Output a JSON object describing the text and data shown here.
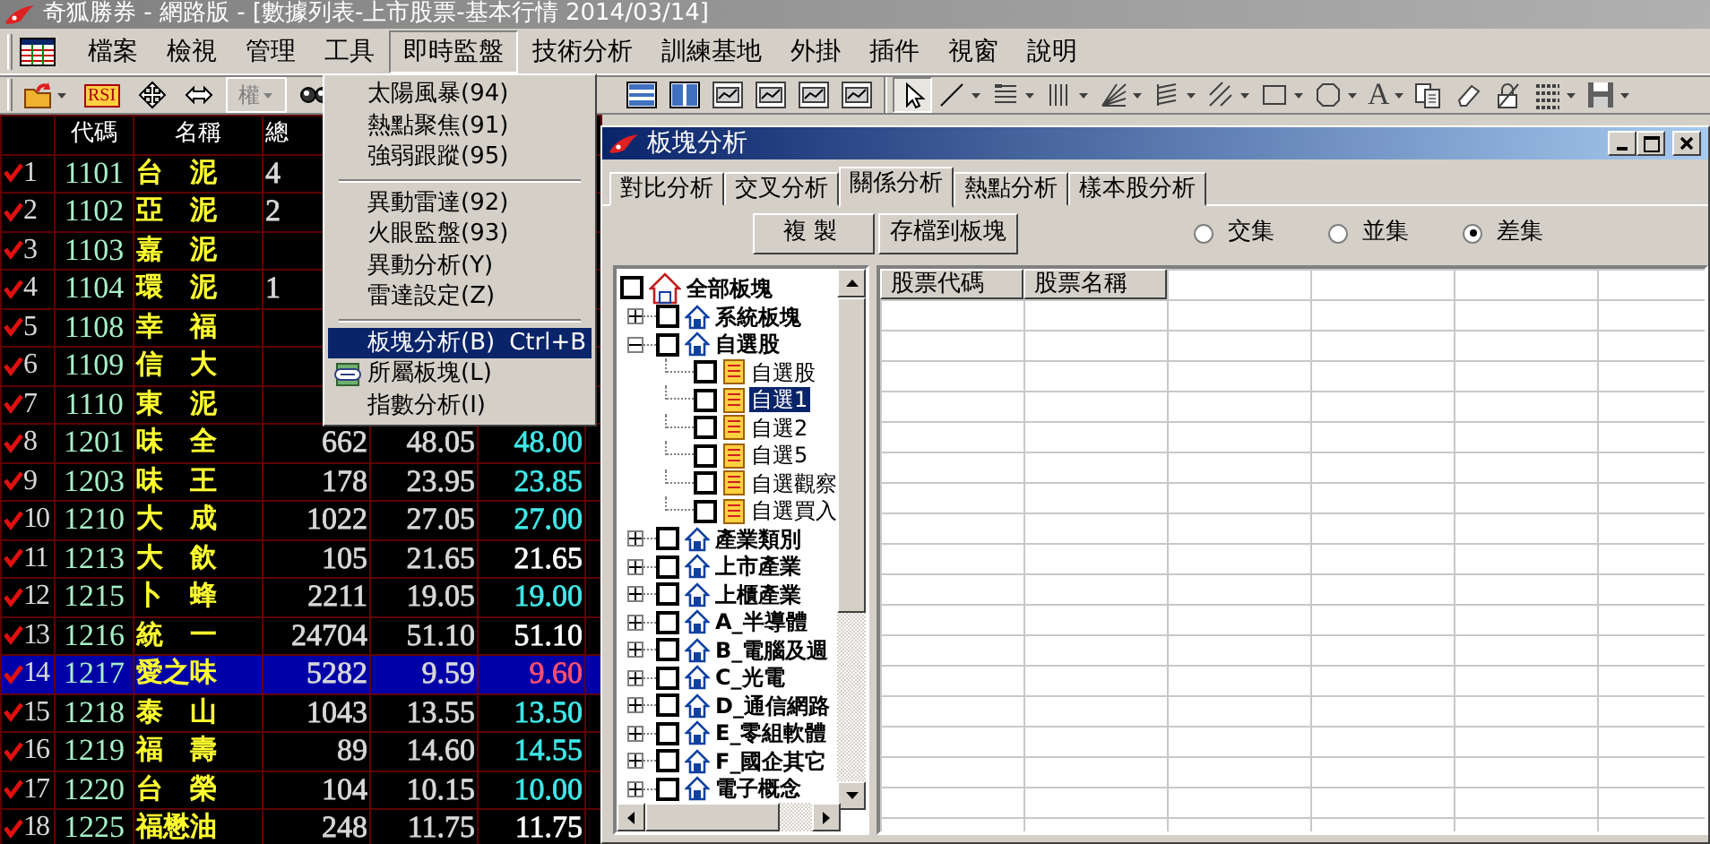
{
  "window": {
    "title": "奇狐勝券 - 網路版 - [數據列表-上市股票-基本行情 2014/03/14]"
  },
  "menu": [
    {
      "label": "檔案",
      "open": false
    },
    {
      "label": "檢視",
      "open": false
    },
    {
      "label": "管理",
      "open": false
    },
    {
      "label": "工具",
      "open": false
    },
    {
      "label": "即時監盤",
      "open": true
    },
    {
      "label": "技術分析",
      "open": false
    },
    {
      "label": "訓練基地",
      "open": false
    },
    {
      "label": "外掛",
      "open": false
    },
    {
      "label": "插件",
      "open": false
    },
    {
      "label": "視窗",
      "open": false
    },
    {
      "label": "說明",
      "open": false
    }
  ],
  "toolbar_left": [
    {
      "kind": "folder",
      "dropdown": true
    },
    {
      "kind": "label",
      "label": "RSI"
    },
    {
      "kind": "cross"
    },
    {
      "kind": "swap"
    },
    {
      "kind": "combo",
      "label": "權",
      "disabled": true
    },
    {
      "kind": "glasses"
    }
  ],
  "toolbar_right": [
    {
      "kind": "rows"
    },
    {
      "kind": "columns"
    },
    {
      "kind": "chart"
    },
    {
      "kind": "chart"
    },
    {
      "kind": "chart"
    },
    {
      "kind": "chart"
    },
    {
      "kind": "sep"
    },
    {
      "kind": "pointer",
      "pressed": true
    },
    {
      "kind": "line",
      "dropdown": true
    },
    {
      "kind": "lines",
      "dropdown": true
    },
    {
      "kind": "bars",
      "dropdown": true
    },
    {
      "kind": "fan",
      "dropdown": true
    },
    {
      "kind": "hatch",
      "dropdown": true
    },
    {
      "kind": "diagonal",
      "dropdown": true
    },
    {
      "kind": "rect",
      "dropdown": true
    },
    {
      "kind": "octagon",
      "dropdown": true
    },
    {
      "kind": "label",
      "label": "A",
      "dropdown": true
    },
    {
      "kind": "copy"
    },
    {
      "kind": "eraser"
    },
    {
      "kind": "lock"
    },
    {
      "kind": "dots",
      "dropdown": true
    },
    {
      "kind": "save",
      "dropdown": true
    }
  ],
  "dropdown": [
    {
      "kind": "item",
      "label": "太陽風暴(94)",
      "selected": false
    },
    {
      "kind": "item",
      "label": "熱點聚焦(91)",
      "selected": false
    },
    {
      "kind": "item",
      "label": "強弱跟蹤(95)",
      "selected": false
    },
    {
      "kind": "separator"
    },
    {
      "kind": "item",
      "label": "異動雷達(92)",
      "selected": false
    },
    {
      "kind": "item",
      "label": "火眼監盤(93)",
      "selected": false
    },
    {
      "kind": "item",
      "label": "異動分析(Y)",
      "selected": false
    },
    {
      "kind": "item",
      "label": "雷達設定(Z)",
      "selected": false
    },
    {
      "kind": "separator"
    },
    {
      "kind": "item",
      "label": "板塊分析(B)",
      "shortcut": "Ctrl+B",
      "selected": true
    },
    {
      "kind": "icon_item",
      "label": "所屬板塊(L)",
      "selected": false
    },
    {
      "kind": "item",
      "label": "指數分析(I)",
      "selected": false
    }
  ],
  "table": {
    "columns": [
      "代碼",
      "名稱",
      "總"
    ],
    "rows": [
      {
        "index": "1",
        "checked": true,
        "code": "1101",
        "name": "台　泥",
        "values": [
          "4"
        ],
        "selected": false
      },
      {
        "index": "2",
        "checked": true,
        "code": "1102",
        "name": "亞　泥",
        "values": [
          "2"
        ],
        "selected": false
      },
      {
        "index": "3",
        "checked": true,
        "code": "1103",
        "name": "嘉　泥",
        "values": [],
        "selected": false
      },
      {
        "index": "4",
        "checked": true,
        "code": "1104",
        "name": "環　泥",
        "values": [
          "1"
        ],
        "selected": false
      },
      {
        "index": "5",
        "checked": true,
        "code": "1108",
        "name": "幸　福",
        "values": [],
        "selected": false
      },
      {
        "index": "6",
        "checked": true,
        "code": "1109",
        "name": "信　大",
        "values": [],
        "selected": false
      },
      {
        "index": "7",
        "checked": true,
        "code": "1110",
        "name": "東　泥",
        "values": [],
        "selected": false
      },
      {
        "index": "8",
        "checked": true,
        "code": "1201",
        "name": "味　全",
        "values": [
          "662",
          "48.05",
          "48.00"
        ],
        "color": "#40e8e8",
        "selected": false
      },
      {
        "index": "9",
        "checked": true,
        "code": "1203",
        "name": "味　王",
        "values": [
          "178",
          "23.95",
          "23.85"
        ],
        "color": "#40e8e8",
        "selected": false
      },
      {
        "index": "10",
        "checked": true,
        "code": "1210",
        "name": "大　成",
        "values": [
          "1022",
          "27.05",
          "27.00"
        ],
        "color": "#40e8e8",
        "selected": false
      },
      {
        "index": "11",
        "checked": true,
        "code": "1213",
        "name": "大　飲",
        "values": [
          "105",
          "21.65",
          "21.65"
        ],
        "color": "#ffffff",
        "selected": false
      },
      {
        "index": "12",
        "checked": true,
        "code": "1215",
        "name": "卜　蜂",
        "values": [
          "2211",
          "19.05",
          "19.00"
        ],
        "color": "#40e8e8",
        "selected": false
      },
      {
        "index": "13",
        "checked": true,
        "code": "1216",
        "name": "統　一",
        "values": [
          "24704",
          "51.10",
          "51.10"
        ],
        "color": "#ffffff",
        "selected": false
      },
      {
        "index": "14",
        "checked": true,
        "code": "1217",
        "name": "愛之味",
        "values": [
          "5282",
          "9.59",
          "9.60"
        ],
        "color": "#ff5070",
        "selected": true
      },
      {
        "index": "15",
        "checked": true,
        "code": "1218",
        "name": "泰　山",
        "values": [
          "1043",
          "13.55",
          "13.50"
        ],
        "color": "#40e8e8",
        "selected": false
      },
      {
        "index": "16",
        "checked": true,
        "code": "1219",
        "name": "福　壽",
        "values": [
          "89",
          "14.60",
          "14.55"
        ],
        "color": "#40e8e8",
        "selected": false
      },
      {
        "index": "17",
        "checked": true,
        "code": "1220",
        "name": "台　榮",
        "values": [
          "104",
          "10.15",
          "10.00"
        ],
        "color": "#40e8e8",
        "selected": false
      },
      {
        "index": "18",
        "checked": true,
        "code": "1225",
        "name": "福懋油",
        "values": [
          "248",
          "11.75",
          "11.75"
        ],
        "color": "#ffffff",
        "selected": false
      }
    ]
  },
  "panel": {
    "title": "板塊分析",
    "tabs": [
      {
        "label": "對比分析",
        "selected": false
      },
      {
        "label": "交叉分析",
        "selected": false
      },
      {
        "label": "關係分析",
        "selected": true
      },
      {
        "label": "熱點分析",
        "selected": false
      },
      {
        "label": "樣本股分析",
        "selected": false
      }
    ],
    "buttons": [
      "複製",
      "存檔到板塊"
    ],
    "options": [
      {
        "label": "交集",
        "selected": false
      },
      {
        "label": "並集",
        "selected": false
      },
      {
        "label": "差集",
        "selected": true
      }
    ],
    "tree": [
      {
        "kind": "root",
        "label": "全部板塊",
        "checked": false,
        "selected": false,
        "children": [
          {
            "kind": "group",
            "label": "系統板塊",
            "checked": false,
            "selected": false,
            "expanded": false
          },
          {
            "kind": "group",
            "label": "自選股",
            "checked": false,
            "selected": false,
            "expanded": true,
            "children": [
              {
                "kind": "leaf",
                "label": "自選股",
                "checked": false,
                "selected": false
              },
              {
                "kind": "leaf",
                "label": "自選1",
                "checked": false,
                "selected": true
              },
              {
                "kind": "leaf",
                "label": "自選2",
                "checked": false,
                "selected": false
              },
              {
                "kind": "leaf",
                "label": "自選5",
                "checked": false,
                "selected": false
              },
              {
                "kind": "leaf",
                "label": "自選觀察",
                "checked": false,
                "selected": false
              },
              {
                "kind": "leaf",
                "label": "自選買入",
                "checked": false,
                "selected": false
              }
            ]
          },
          {
            "kind": "group",
            "label": "產業類別",
            "checked": false,
            "selected": false,
            "expanded": false
          },
          {
            "kind": "group",
            "label": "上市產業",
            "checked": false,
            "selected": false,
            "expanded": false
          },
          {
            "kind": "group",
            "label": "上櫃產業",
            "checked": false,
            "selected": false,
            "expanded": false
          },
          {
            "kind": "group",
            "label": "A_半導體",
            "checked": false,
            "selected": false,
            "expanded": false
          },
          {
            "kind": "group",
            "label": "B_電腦及週",
            "checked": false,
            "selected": false,
            "expanded": false
          },
          {
            "kind": "group",
            "label": "C_光電",
            "checked": false,
            "selected": false,
            "expanded": false
          },
          {
            "kind": "group",
            "label": "D_通信網路",
            "checked": false,
            "selected": false,
            "expanded": false
          },
          {
            "kind": "group",
            "label": "E_零組軟體",
            "checked": false,
            "selected": false,
            "expanded": false
          },
          {
            "kind": "group",
            "label": "F_國企其它",
            "checked": false,
            "selected": false,
            "expanded": false
          },
          {
            "kind": "group",
            "label": "電子概念",
            "checked": false,
            "selected": false,
            "expanded": false
          }
        ]
      }
    ],
    "grid": {
      "columns": [
        "股票代碼",
        "股票名稱"
      ]
    }
  }
}
